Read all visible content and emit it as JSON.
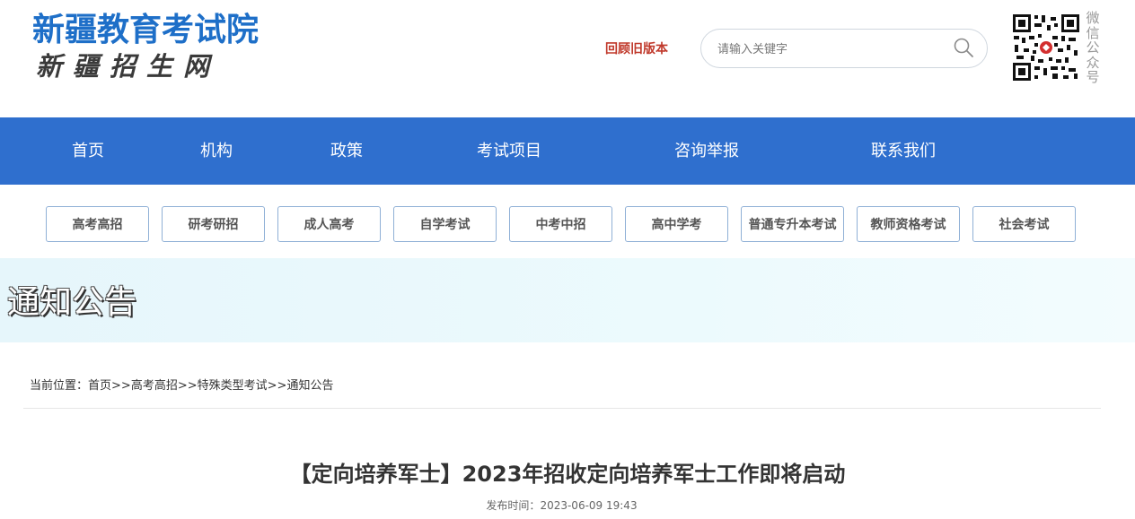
{
  "header": {
    "logo_title": "新疆教育考试院",
    "logo_subtitle": "新疆招生网",
    "old_version_link": "回顾旧版本",
    "search": {
      "placeholder": "请输入关键字",
      "value": ""
    },
    "qr_label": "微信公众号"
  },
  "nav": {
    "items": [
      {
        "label": "首页"
      },
      {
        "label": "机构"
      },
      {
        "label": "政策"
      },
      {
        "label": "考试项目"
      },
      {
        "label": "咨询举报"
      },
      {
        "label": "联系我们"
      }
    ]
  },
  "subtabs": [
    {
      "label": "高考高招"
    },
    {
      "label": "研考研招"
    },
    {
      "label": "成人高考"
    },
    {
      "label": "自学考试"
    },
    {
      "label": "中考中招"
    },
    {
      "label": "高中学考"
    },
    {
      "label": "普通专升本考试"
    },
    {
      "label": "教师资格考试"
    },
    {
      "label": "社会考试"
    }
  ],
  "banner": {
    "title": "通知公告"
  },
  "breadcrumb": {
    "prefix": "当前位置：",
    "items": [
      "首页",
      "高考高招",
      "特殊类型考试",
      "通知公告"
    ],
    "separator": ">>"
  },
  "article": {
    "title": "【定向培养军士】2023年招收定向培养军士工作即将启动",
    "publish_label": "发布时间：",
    "publish_time": "2023-06-09 19:43"
  },
  "colors": {
    "nav_bg": "#2f6fce",
    "logo_blue": "#1e6fc8",
    "old_version_red": "#c0392b",
    "tab_border": "#8fb0d6"
  }
}
